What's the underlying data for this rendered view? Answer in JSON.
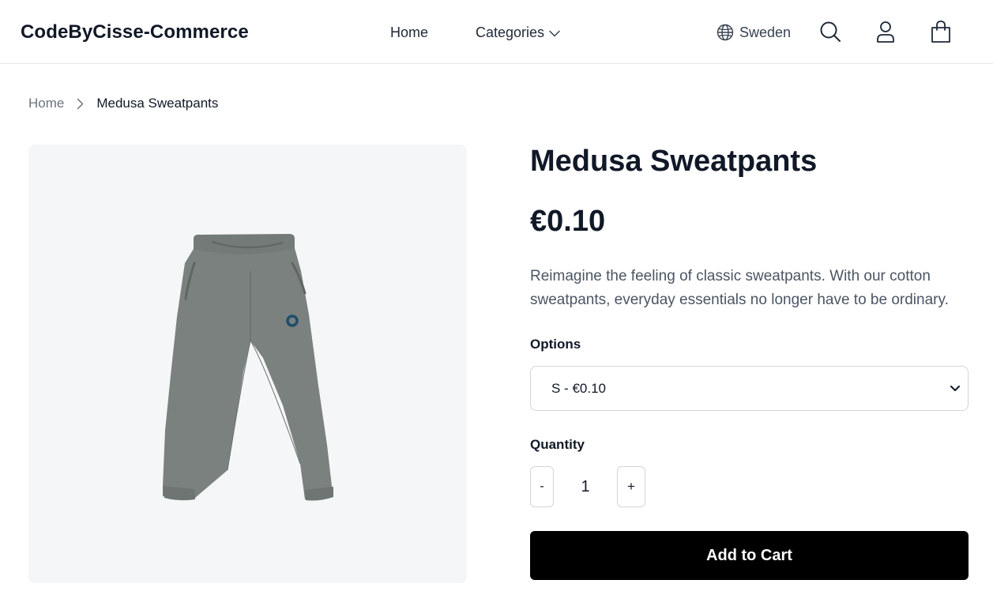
{
  "header": {
    "logo": "CodeByCisse-Commerce",
    "nav": {
      "home": "Home",
      "categories": "Categories"
    },
    "region": "Sweden",
    "icons": [
      "globe-icon",
      "search-icon",
      "user-icon",
      "shopping-bag-icon",
      "chevron-down-icon"
    ]
  },
  "breadcrumb": {
    "home": "Home",
    "current": "Medusa Sweatpants"
  },
  "product": {
    "title": "Medusa Sweatpants",
    "price": "€0.10",
    "description": "Reimagine the feeling of classic sweatpants. With our cotton sweatpants, everyday essentials no longer have to be ordinary.",
    "options_label": "Options",
    "selected_option": "S - €0.10",
    "quantity_label": "Quantity",
    "quantity": "1",
    "minus_label": "-",
    "plus_label": "+",
    "add_to_cart": "Add to Cart"
  },
  "colors": {
    "text": "#111827",
    "muted": "#6b7280",
    "image_bg": "#f5f6f8",
    "button_bg": "#000000",
    "border": "#d1d5db",
    "pants": "#7b817f",
    "logo_accent": "#1f4e6b"
  }
}
